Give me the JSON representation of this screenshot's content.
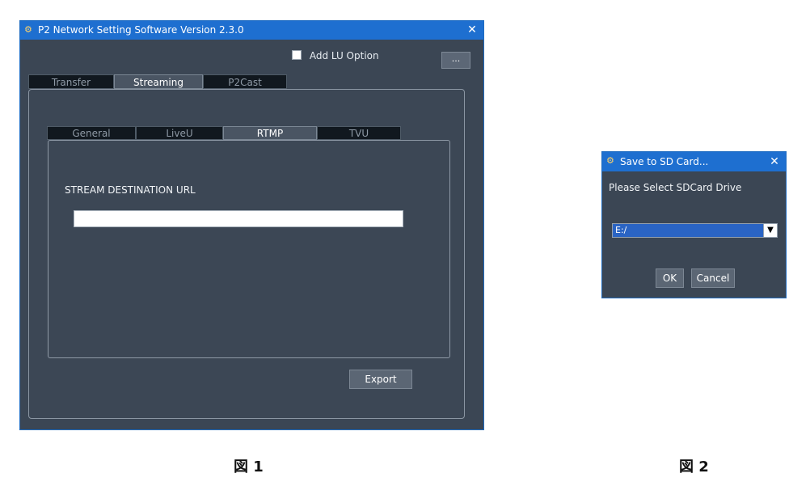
{
  "window": {
    "title": "P2 Network Setting Software  Version 2.3.0",
    "close": "✕",
    "icon": "settings-app-icon"
  },
  "options": {
    "add_lu": "Add LU Option",
    "more": "..."
  },
  "tabs": [
    "Transfer",
    "Streaming",
    "P2Cast"
  ],
  "subtabs": [
    "General",
    "LiveU",
    "RTMP",
    "TVU"
  ],
  "rtmp": {
    "label": "STREAM DESTINATION URL",
    "url_value": ""
  },
  "buttons": {
    "export": "Export"
  },
  "dialog": {
    "title": "Save to SD Card...",
    "close": "✕",
    "prompt": "Please Select SDCard Drive",
    "drive_value": "E:/",
    "ok": "OK",
    "cancel": "Cancel"
  },
  "captions": {
    "fig1": "図 1",
    "fig2": "図 2"
  },
  "colors": {
    "window_bg": "#3b4654",
    "titlebar": "#1e6fd0",
    "select_bg": "#2a64c4"
  }
}
